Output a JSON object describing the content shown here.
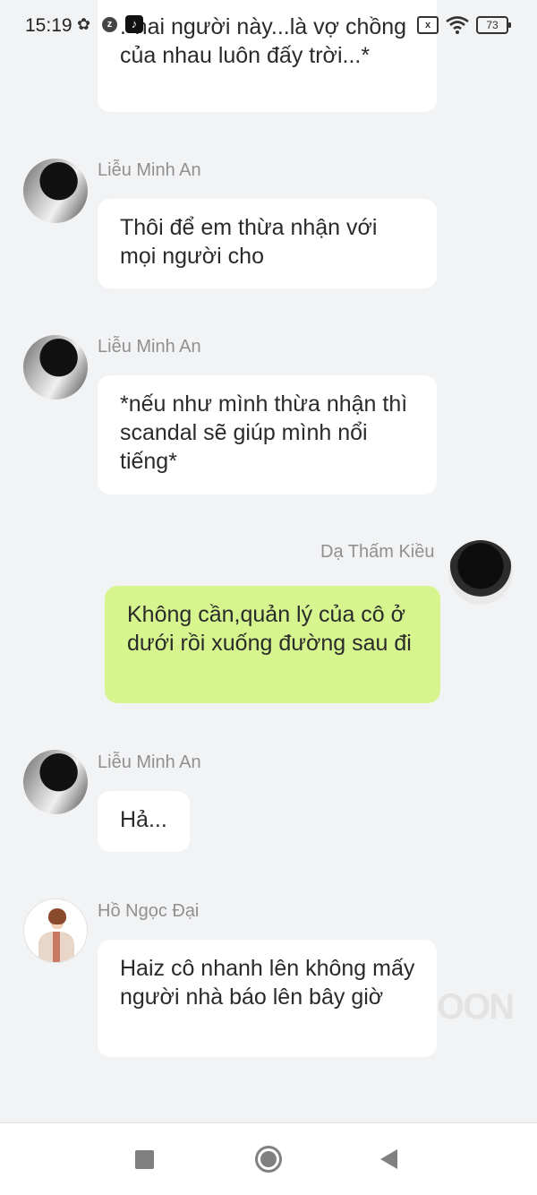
{
  "status_bar": {
    "time": "15:19",
    "battery": "73",
    "sim_label": "x"
  },
  "messages": [
    {
      "sender": "",
      "side": "left",
      "text": ".*hai người này...là vợ chồng của nhau luôn đấy trời...*"
    },
    {
      "sender": "Liễu Minh An",
      "side": "left",
      "text": "Thôi để em thừa nhận với mọi người cho"
    },
    {
      "sender": "Liễu Minh An",
      "side": "left",
      "text": "*nếu như mình thừa nhận thì scandal sẽ giúp mình nổi tiếng*"
    },
    {
      "sender": "Dạ Thấm Kiều",
      "side": "right",
      "text": "Không cần,quản lý của cô ở dưới rồi xuống đường sau đi"
    },
    {
      "sender": "Liễu Minh An",
      "side": "left",
      "text": "Hả..."
    },
    {
      "sender": "Hồ Ngọc Đại",
      "side": "left",
      "text": "Haiz cô nhanh lên không mấy người nhà báo lên bây giờ"
    }
  ],
  "watermark": "OON",
  "icons": {
    "settings": "gear-icon",
    "tiktok": "tiktok-icon",
    "wifi": "wifi-icon",
    "battery": "battery-icon",
    "nav_recent": "square-icon",
    "nav_home": "circle-icon",
    "nav_back": "triangle-back-icon"
  }
}
